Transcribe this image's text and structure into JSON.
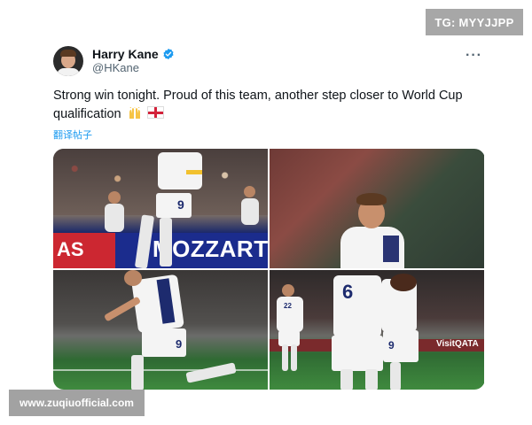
{
  "watermark_top": "TG: MYYJJPP",
  "watermark_bottom": "www.zuqiuofficial.com",
  "tweet": {
    "display_name": "Harry Kane",
    "handle": "@HKane",
    "more_label": "···",
    "text": "Strong win tonight. Proud of this team, another step closer to World Cup qualification",
    "emojis": [
      "raised-hands",
      "england-flag"
    ],
    "translate_label": "翻译帖子"
  },
  "photos": {
    "p1": {
      "board_left": "AS",
      "board_main": "MOZZART",
      "shirt_number": "9"
    },
    "p2": {},
    "p3": {
      "shirt_number": "9"
    },
    "p4": {
      "shirt_number_back": "6",
      "shirt_number_right": "9",
      "shirt_number_far": "22",
      "board_text": "VisitQATA"
    }
  },
  "colors": {
    "verified": "#1d9bf0",
    "link": "#1d9bf0",
    "badge": "#a7a7a7",
    "navy": "#1d2b6e"
  }
}
